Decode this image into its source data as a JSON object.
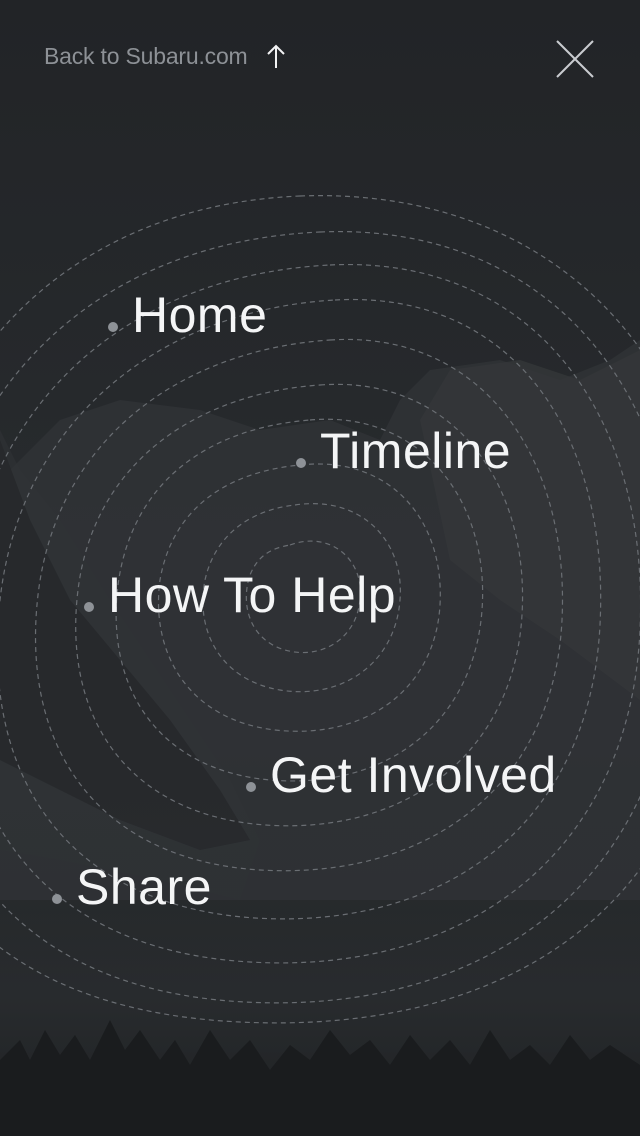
{
  "header": {
    "back_label": "Back to Subaru.com",
    "back_icon": "arrow-up-icon",
    "close_icon": "close-icon"
  },
  "nav": {
    "items": [
      {
        "label": "Home"
      },
      {
        "label": "Timeline"
      },
      {
        "label": "How To Help"
      },
      {
        "label": "Get Involved"
      },
      {
        "label": "Share"
      }
    ]
  },
  "colors": {
    "background": "#222427",
    "text": "#f4f5f6",
    "muted_text": "#8d9196",
    "dot": "#8e9297",
    "contour_line": "#6a6e73"
  }
}
